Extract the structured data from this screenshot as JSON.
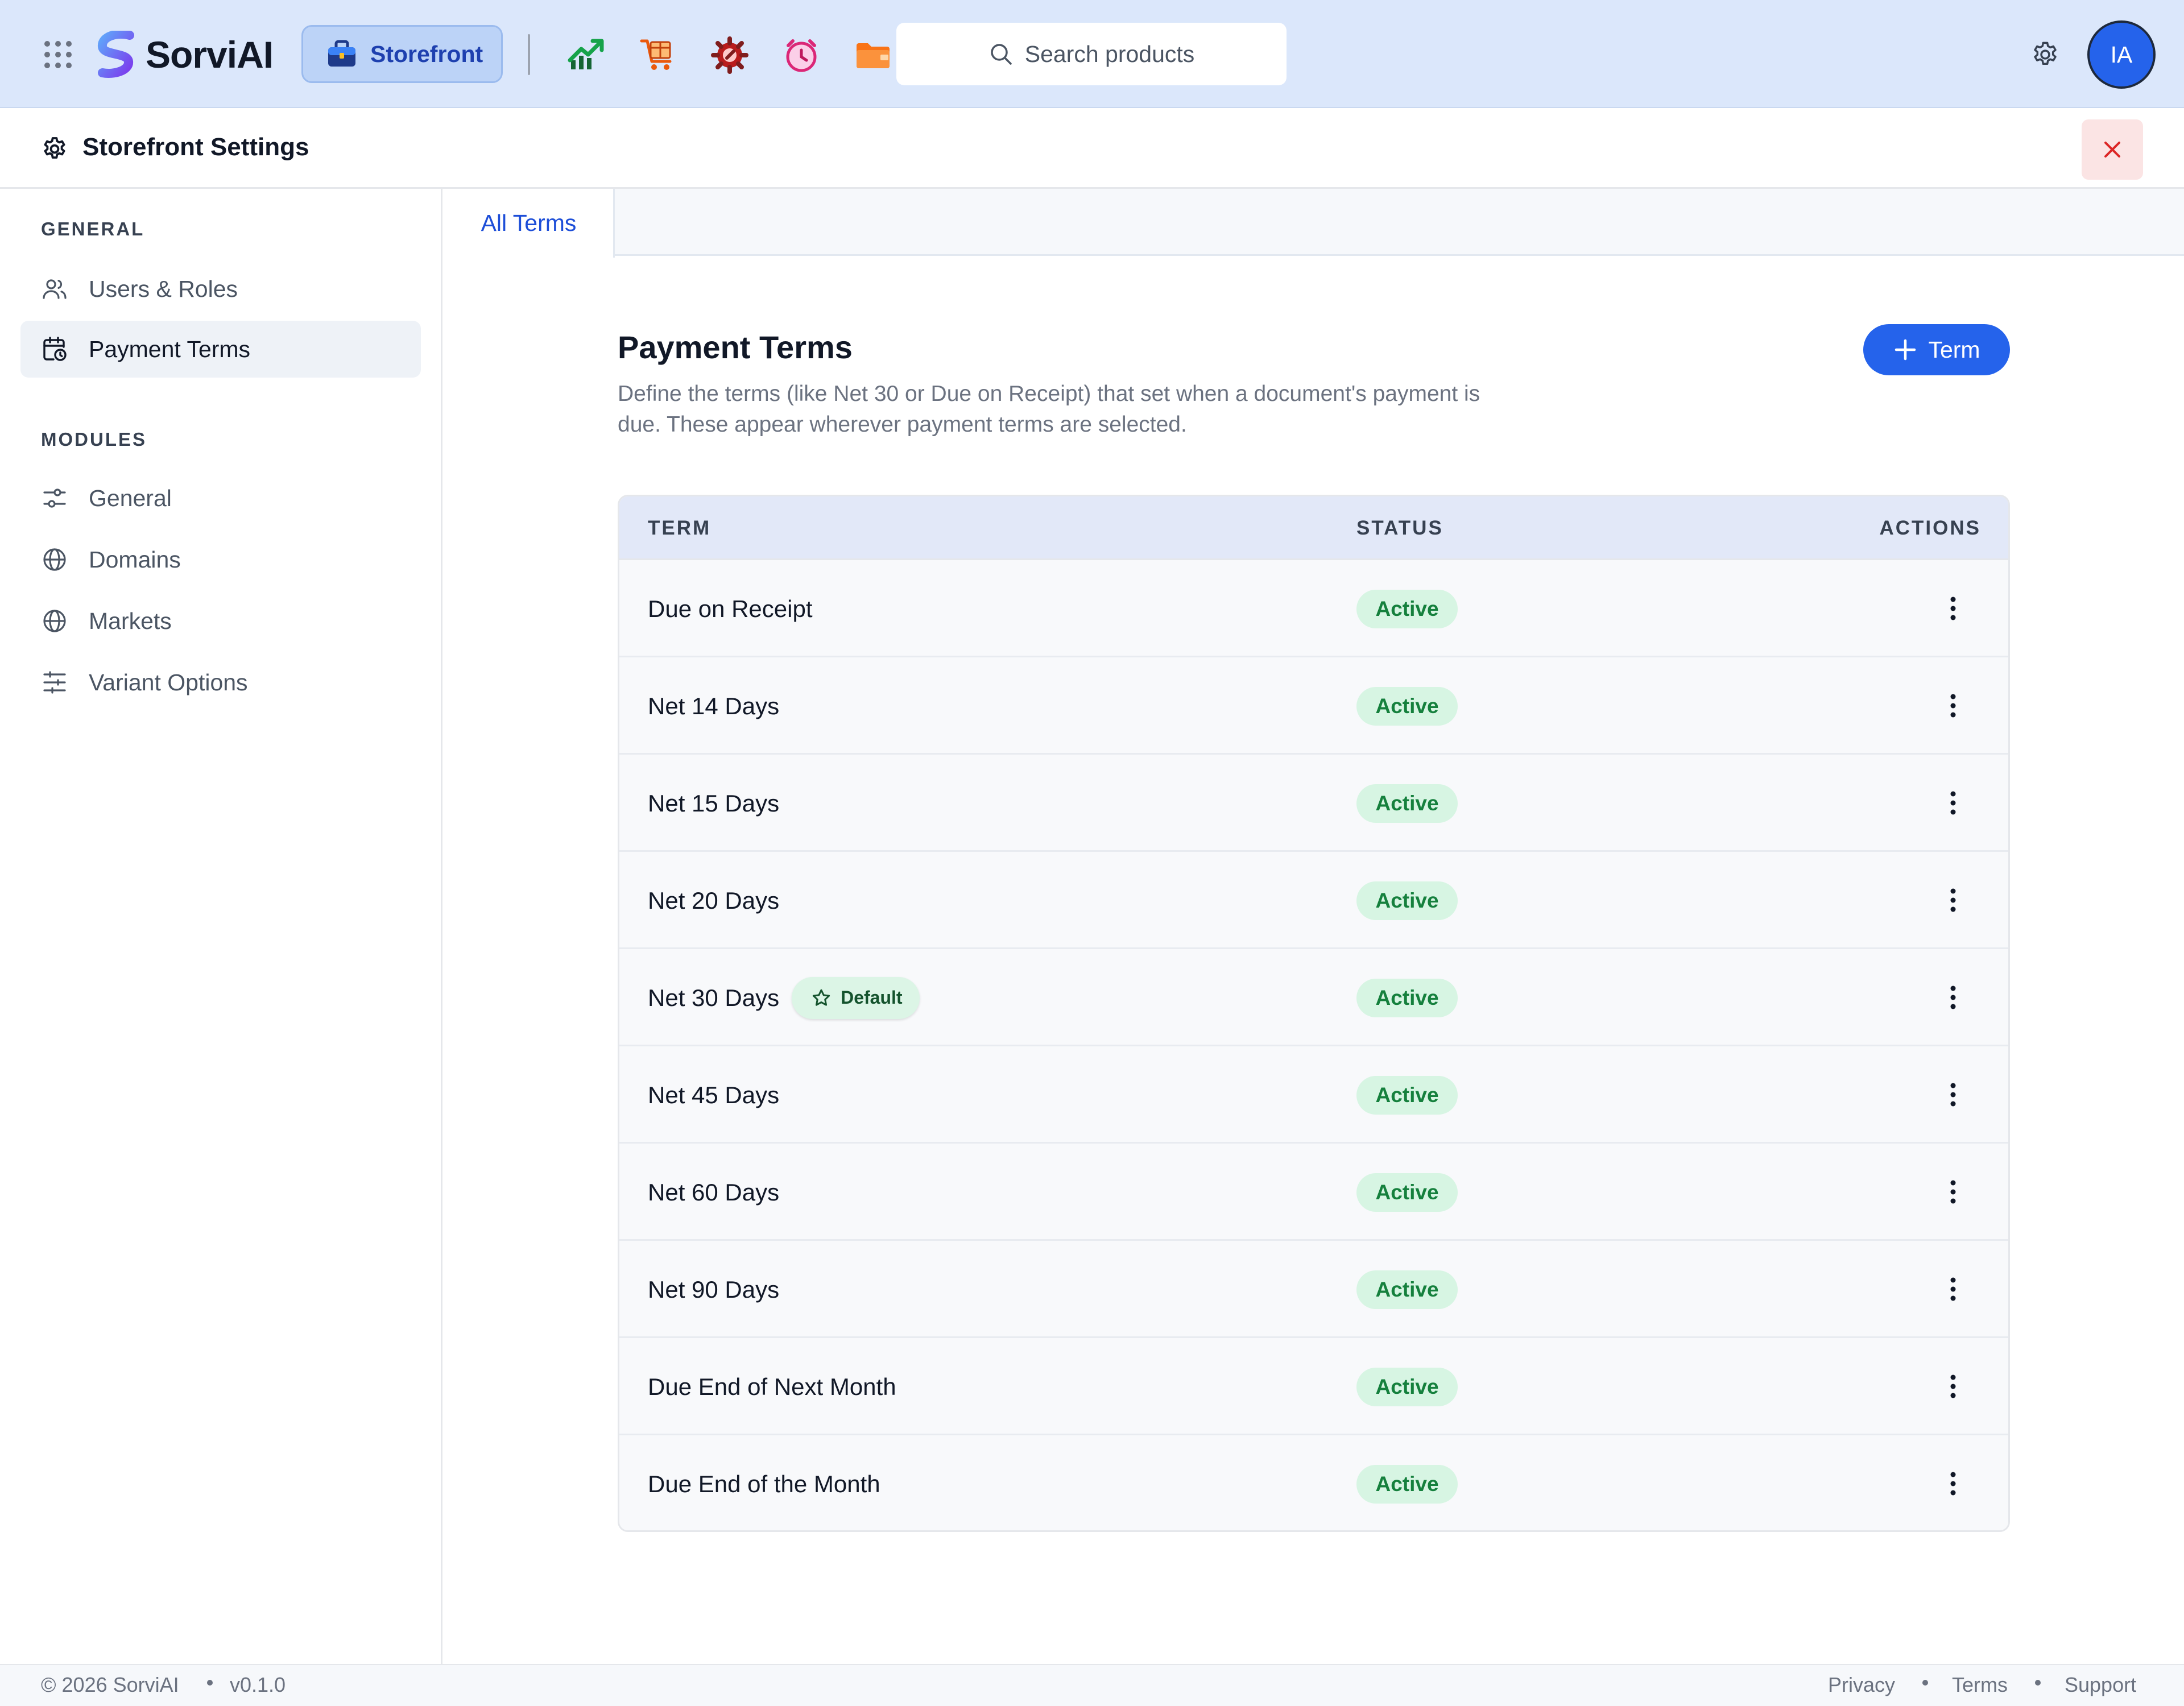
{
  "topbar": {
    "brand": "SorviAI",
    "active_app": "Storefront",
    "quick_apps": [
      "chart-trending-up-icon",
      "package-cart-icon",
      "wrench-gear-icon",
      "alarm-clock-icon",
      "folder-icon"
    ],
    "search_placeholder": "Search products",
    "user_initials": "IA"
  },
  "settings": {
    "title": "Storefront Settings"
  },
  "sidebar": {
    "sections": [
      {
        "label": "GENERAL",
        "items": [
          {
            "label": "Users & Roles",
            "icon": "users-icon",
            "active": false
          },
          {
            "label": "Payment Terms",
            "icon": "calendar-clock-icon",
            "active": true
          }
        ]
      },
      {
        "label": "MODULES",
        "items": [
          {
            "label": "General",
            "icon": "sliders-icon",
            "active": false
          },
          {
            "label": "Domains",
            "icon": "globe-icon",
            "active": false
          },
          {
            "label": "Markets",
            "icon": "globe-icon",
            "active": false
          },
          {
            "label": "Variant Options",
            "icon": "sliders-horizontal-icon",
            "active": false
          }
        ]
      }
    ]
  },
  "tabs": [
    {
      "label": "All Terms",
      "active": true
    }
  ],
  "main": {
    "title": "Payment Terms",
    "description": "Define the terms (like Net 30 or Due on Receipt) that set when a document's payment is due. These appear wherever payment terms are selected.",
    "add_button": "Term"
  },
  "table": {
    "columns": [
      "TERM",
      "STATUS",
      "ACTIONS"
    ],
    "rows": [
      {
        "term": "Due on Receipt",
        "status": "Active",
        "default": false
      },
      {
        "term": "Net 14 Days",
        "status": "Active",
        "default": false
      },
      {
        "term": "Net 15 Days",
        "status": "Active",
        "default": false
      },
      {
        "term": "Net 20 Days",
        "status": "Active",
        "default": false
      },
      {
        "term": "Net 30 Days",
        "status": "Active",
        "default": true
      },
      {
        "term": "Net 45 Days",
        "status": "Active",
        "default": false
      },
      {
        "term": "Net 60 Days",
        "status": "Active",
        "default": false
      },
      {
        "term": "Net 90 Days",
        "status": "Active",
        "default": false
      },
      {
        "term": "Due End of Next Month",
        "status": "Active",
        "default": false
      },
      {
        "term": "Due End of the Month",
        "status": "Active",
        "default": false
      }
    ],
    "default_label": "Default"
  },
  "footer": {
    "copyright": "© 2026 SorviAI",
    "version": "v0.1.0",
    "links": [
      "Privacy",
      "Terms",
      "Support"
    ]
  },
  "colors": {
    "accent": "#2563eb",
    "topbar_bg": "#dbe7fb",
    "status_active_bg": "#d7f5e3",
    "status_active_text": "#15803d",
    "close_bg": "#fbe4e4",
    "close_icon": "#dc2626"
  }
}
